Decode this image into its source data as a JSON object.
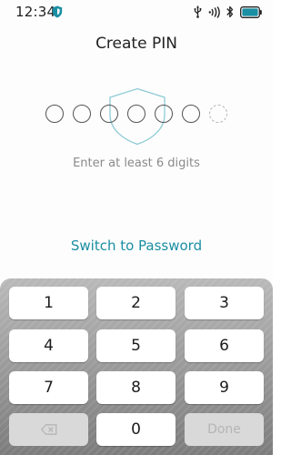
{
  "status_bar": {
    "time": "12:34",
    "icons": [
      "shield-icon",
      "usb-icon",
      "nfc-icon",
      "bluetooth-icon",
      "battery-icon"
    ],
    "accent_color": "#1a8ea3"
  },
  "screen": {
    "title": "Create PIN",
    "pin_slots": 7,
    "hint": "Enter at least 6 digits",
    "switch_label": "Switch to Password"
  },
  "keypad": {
    "keys": [
      "1",
      "2",
      "3",
      "4",
      "5",
      "6",
      "7",
      "8",
      "9",
      "backspace-icon",
      "0",
      "Done"
    ],
    "key_1": "1",
    "key_2": "2",
    "key_3": "3",
    "key_4": "4",
    "key_5": "5",
    "key_6": "6",
    "key_7": "7",
    "key_8": "8",
    "key_9": "9",
    "key_0": "0",
    "done_label": "Done"
  }
}
